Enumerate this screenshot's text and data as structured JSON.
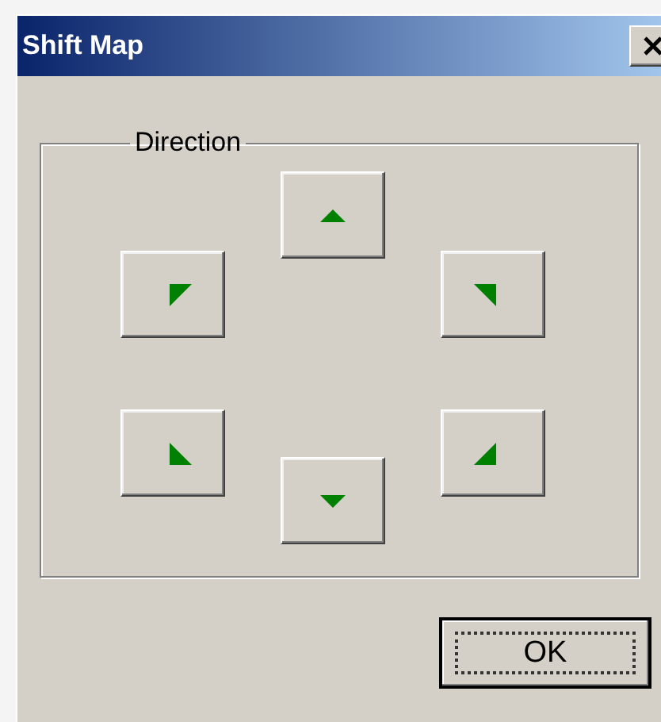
{
  "window": {
    "title": "Shift Map"
  },
  "group": {
    "label": "Direction"
  },
  "direction_buttons": [
    {
      "kind": "up"
    },
    {
      "kind": "up-left"
    },
    {
      "kind": "up-right"
    },
    {
      "kind": "down-left"
    },
    {
      "kind": "down-right"
    },
    {
      "kind": "down"
    }
  ],
  "ok_button": {
    "label": "OK",
    "default": true
  }
}
